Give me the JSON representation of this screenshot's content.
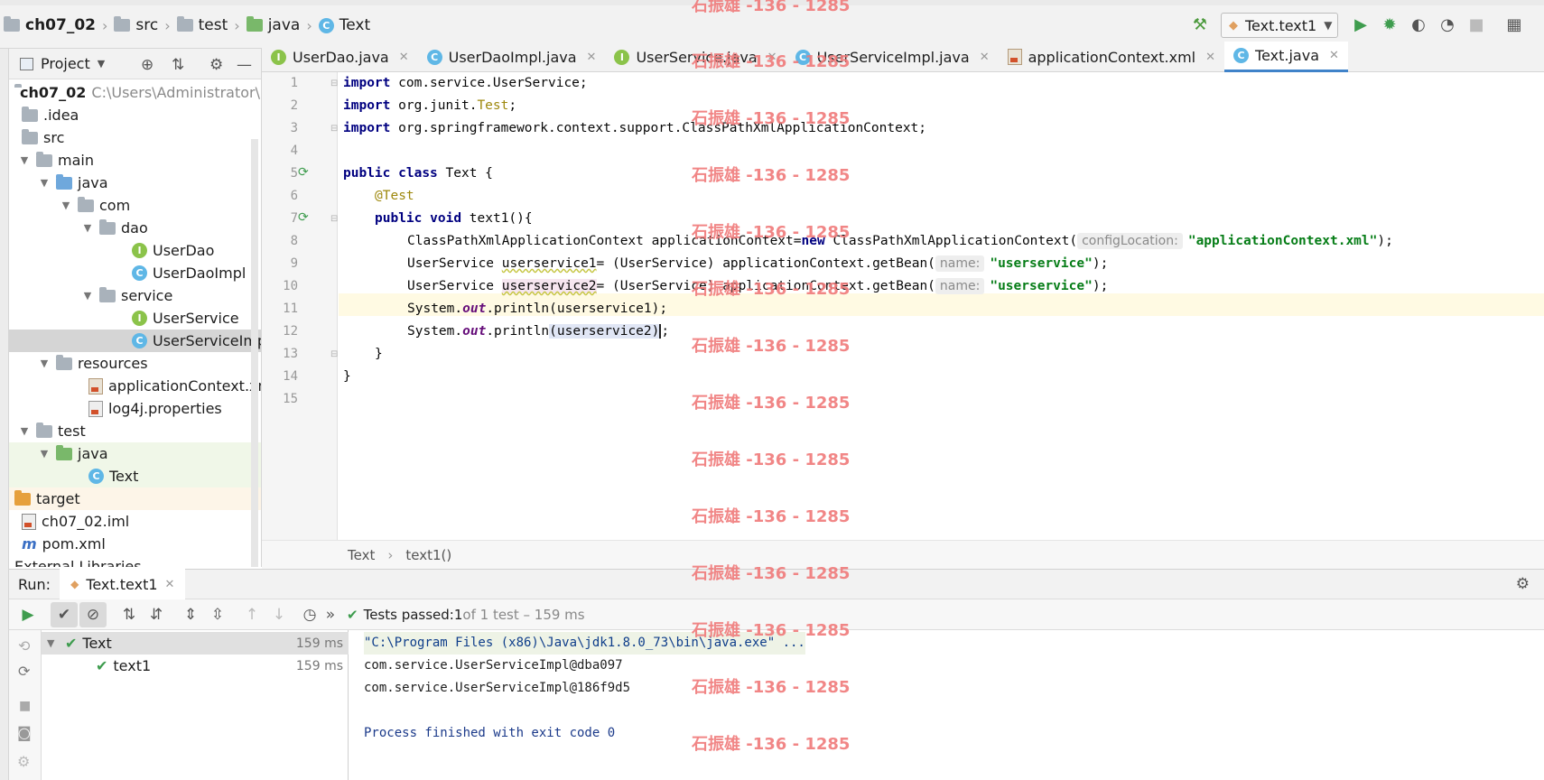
{
  "breadcrumb": [
    "ch07_02",
    "src",
    "test",
    "java",
    "Text"
  ],
  "run_config": "Text.text1",
  "project_panel": {
    "title": "Project",
    "root_name": "ch07_02",
    "root_path": "C:\\Users\\Administrator\\Des",
    "items": [
      {
        "label": "ch07_02"
      },
      {
        "label": ".idea"
      },
      {
        "label": "src"
      },
      {
        "label": "main"
      },
      {
        "label": "java"
      },
      {
        "label": "com"
      },
      {
        "label": "dao"
      },
      {
        "label": "UserDao"
      },
      {
        "label": "UserDaoImpl"
      },
      {
        "label": "service"
      },
      {
        "label": "UserService"
      },
      {
        "label": "UserServiceImpl"
      },
      {
        "label": "resources"
      },
      {
        "label": "applicationContext.xml"
      },
      {
        "label": "log4j.properties"
      },
      {
        "label": "test"
      },
      {
        "label": "java"
      },
      {
        "label": "Text"
      },
      {
        "label": "target"
      },
      {
        "label": "ch07_02.iml"
      },
      {
        "label": "pom.xml"
      },
      {
        "label": "External Libraries"
      }
    ]
  },
  "tabs": [
    {
      "label": "UserDao.java"
    },
    {
      "label": "UserDaoImpl.java"
    },
    {
      "label": "UserService.java"
    },
    {
      "label": "UserServiceImpl.java"
    },
    {
      "label": "applicationContext.xml"
    },
    {
      "label": "Text.java"
    }
  ],
  "code": {
    "line_numbers": [
      "1",
      "2",
      "3",
      "4",
      "5",
      "6",
      "7",
      "8",
      "9",
      "10",
      "11",
      "12",
      "13",
      "14",
      "15"
    ],
    "l1": "com.service.UserService;",
    "l2_pkg": "org.junit.",
    "l2_cls": "Test",
    "l2_end": ";",
    "l3": "org.springframework.context.support.ClassPathXmlApplicationContext;",
    "kw_import": "import",
    "kw_public": "public",
    "kw_class": "class",
    "kw_void": "void",
    "kw_new": "new",
    "class_name": "Text {",
    "annotation": "@Test",
    "method": "text1(){",
    "l8_a": "ClassPathXmlApplicationContext applicationContext=",
    "l8_b": "ClassPathXmlApplicationContext(",
    "hint_config": "configLocation:",
    "l8_str": "\"applicationContext.xml\"",
    "l8_end": ");",
    "l9_a": "UserService ",
    "l9_var": "userservice1",
    "l9_b": "= (UserService) applicationContext.getBean(",
    "hint_name": "name:",
    "l9_str": "\"userservice\"",
    "l9_end": ");",
    "l10_var": "userservice2",
    "l11_a": "System.",
    "l11_out": "out",
    "l11_b": ".println(userservice1);",
    "l12_b": ".println",
    "l12_c": "(userservice2)",
    "l12_end": ";",
    "l13": "}",
    "l14": "}"
  },
  "editor_crumb": [
    "Text",
    "text1()"
  ],
  "run": {
    "label": "Run:",
    "tab": "Text.text1",
    "status_main": "Tests passed: ",
    "status_count": "1",
    "status_rest": " of 1 test – 159 ms",
    "tests": [
      {
        "name": "Text",
        "time": "159 ms"
      },
      {
        "name": "text1",
        "time": "159 ms"
      }
    ],
    "console": [
      "\"C:\\Program Files (x86)\\Java\\jdk1.8.0_73\\bin\\java.exe\" ...",
      "com.service.UserServiceImpl@dba097",
      "com.service.UserServiceImpl@186f9d5",
      "",
      "Process finished with exit code 0"
    ]
  },
  "watermark": "石振雄 -136 - 1285"
}
